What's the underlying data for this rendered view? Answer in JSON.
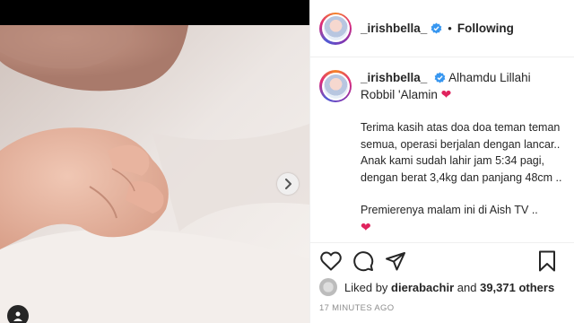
{
  "post": {
    "username": "_irishbella_",
    "follow_status": "Following",
    "separator": "•"
  },
  "caption": {
    "username": "_irishbella_",
    "first_line": "Alhamdu Lillahi Robbil 'Alamin",
    "paragraph1": "Terima kasih atas doa doa teman teman semua, operasi berjalan dengan lancar.. Anak kami sudah lahir jam 5:34 pagi, dengan berat 3,4kg dan panjang 48cm ..",
    "paragraph2": "Premierenya malam ini di Aish TV .."
  },
  "likes": {
    "prefix": "Liked by",
    "liker": "dierabachir",
    "middle": "and",
    "count": "39,371 others"
  },
  "timestamp": "17 MINUTES AGO",
  "colors": {
    "verified": "#3897f0",
    "heart": "#e0245e",
    "text": "#262626",
    "muted": "#8e8e8e"
  },
  "icons": [
    "verified-icon",
    "heart-icon",
    "comment-icon",
    "share-icon",
    "bookmark-icon",
    "chevron-right-icon",
    "user-tag-icon"
  ]
}
